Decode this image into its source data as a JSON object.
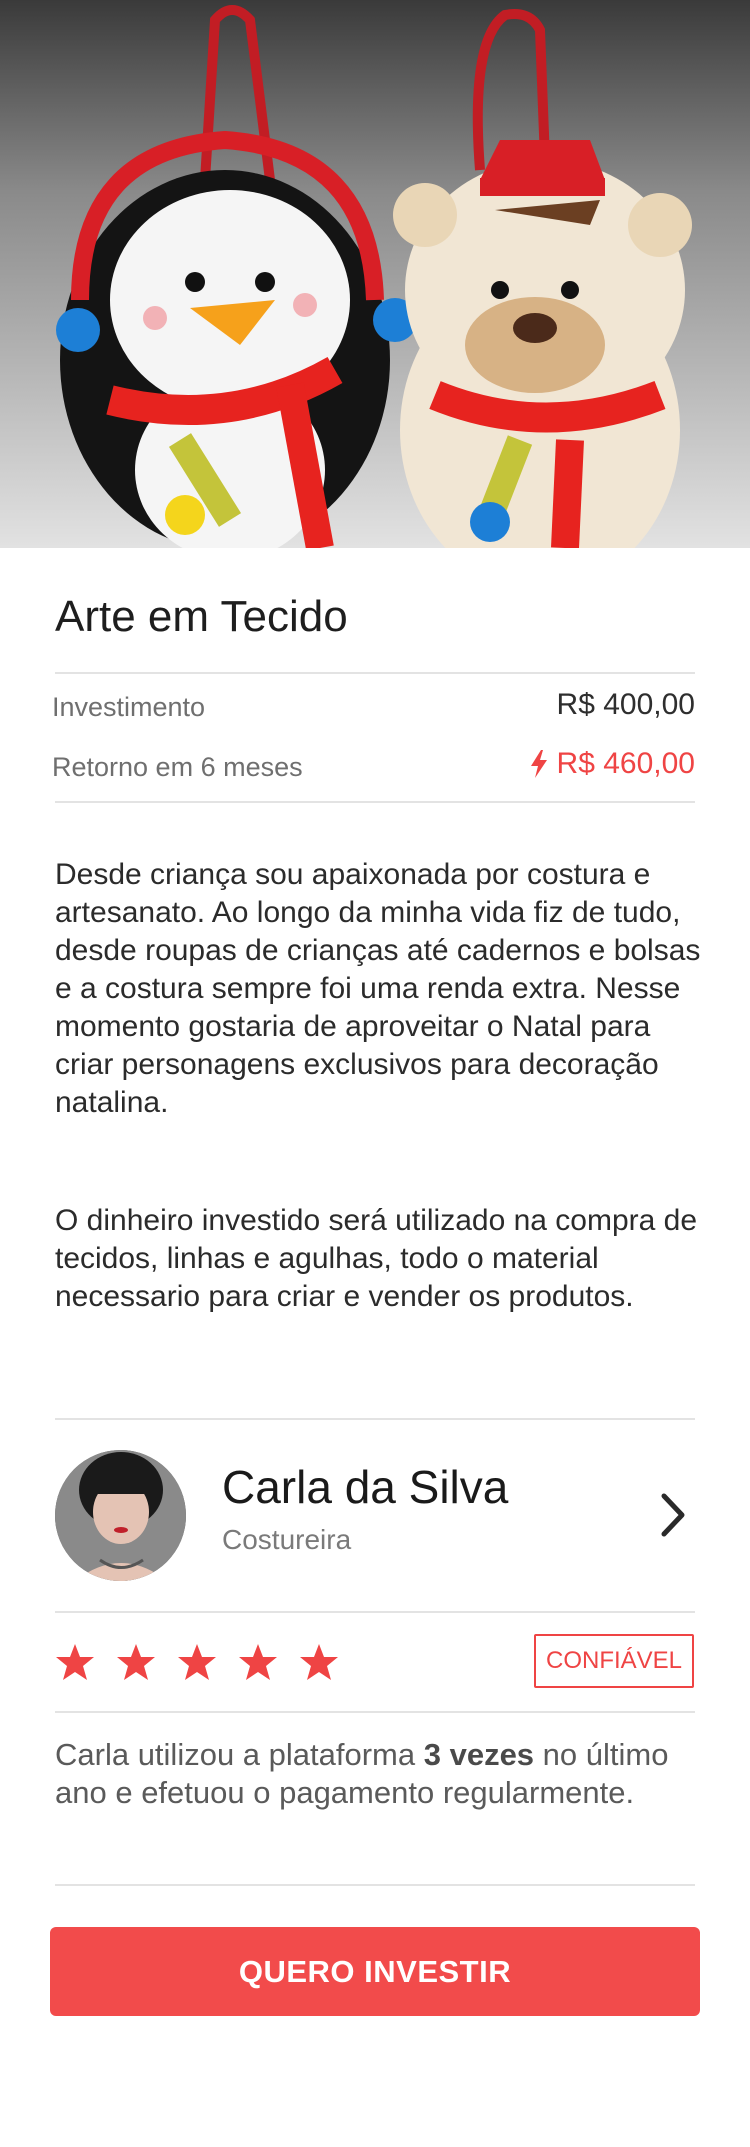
{
  "product": {
    "title": "Arte em Tecido",
    "image_alt": "felt-ornaments-photo"
  },
  "investment": {
    "label": "Investimento",
    "value": "R$ 400,00",
    "return_label": "Retorno em 6 meses",
    "return_value": "R$ 460,00",
    "accent_color": "#ef4444"
  },
  "description": {
    "paragraph1": "Desde criança sou apaixonada por costura e artesanato. Ao longo da minha vida fiz de tudo, desde roupas de crianças até cadernos e bolsas e a costura sempre foi uma renda extra. Nesse momento gostaria de aproveitar o Natal para criar personagens exclusivos para decoração natalina.",
    "paragraph2": "O dinheiro investido será utilizado na compra de tecidos, linhas e agulhas, todo o material necessario para criar e vender os produtos."
  },
  "owner": {
    "name": "Carla da Silva",
    "role": "Costureira"
  },
  "rating": {
    "stars": 5,
    "max": 5,
    "badge": "CONFIÁVEL"
  },
  "trust": {
    "prefix": "Carla utilizou a plataforma ",
    "highlight": "3 vezes",
    "suffix": " no último ano e efetuou o pagamento regularmente."
  },
  "cta": {
    "label": "QUERO INVESTIR",
    "color": "#f24b4b"
  }
}
